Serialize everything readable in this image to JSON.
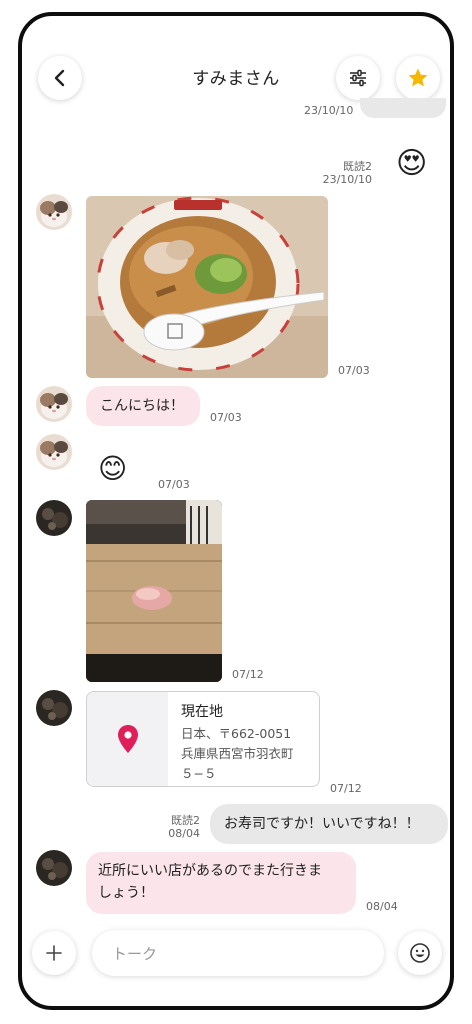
{
  "header": {
    "title": "すみまさん"
  },
  "colors": {
    "accent_star": "#f5b800",
    "location_pin": "#e01e5a",
    "pink_bubble": "#fbe5ea",
    "gray_bubble": "#e8e8e8"
  },
  "messages": {
    "m0": {
      "date": "23/10/10"
    },
    "m1": {
      "read": "既読2",
      "date": "23/10/10",
      "emoji": "😍"
    },
    "m2": {
      "date": "07/03"
    },
    "m3": {
      "text": "こんにちは！",
      "date": "07/03"
    },
    "m4": {
      "emoji": "😊",
      "date": "07/03"
    },
    "m5": {
      "date": "07/12"
    },
    "m6": {
      "title": "現在地",
      "line1": "日本、〒662-0051",
      "line2": "兵庫県西宮市羽衣町",
      "line3": "５−５",
      "date": "07/12"
    },
    "m7": {
      "read": "既読2",
      "date": "08/04",
      "text": "お寿司ですか！いいですね！！"
    },
    "m8": {
      "line1": "近所にいい店があるのでまた行きま",
      "line2": "しょう！",
      "date": "08/04"
    }
  },
  "input": {
    "placeholder": "トーク"
  },
  "icons": [
    "back-icon",
    "filter-icon",
    "star-icon",
    "plus-icon",
    "emoji-icon",
    "location-pin-icon"
  ]
}
